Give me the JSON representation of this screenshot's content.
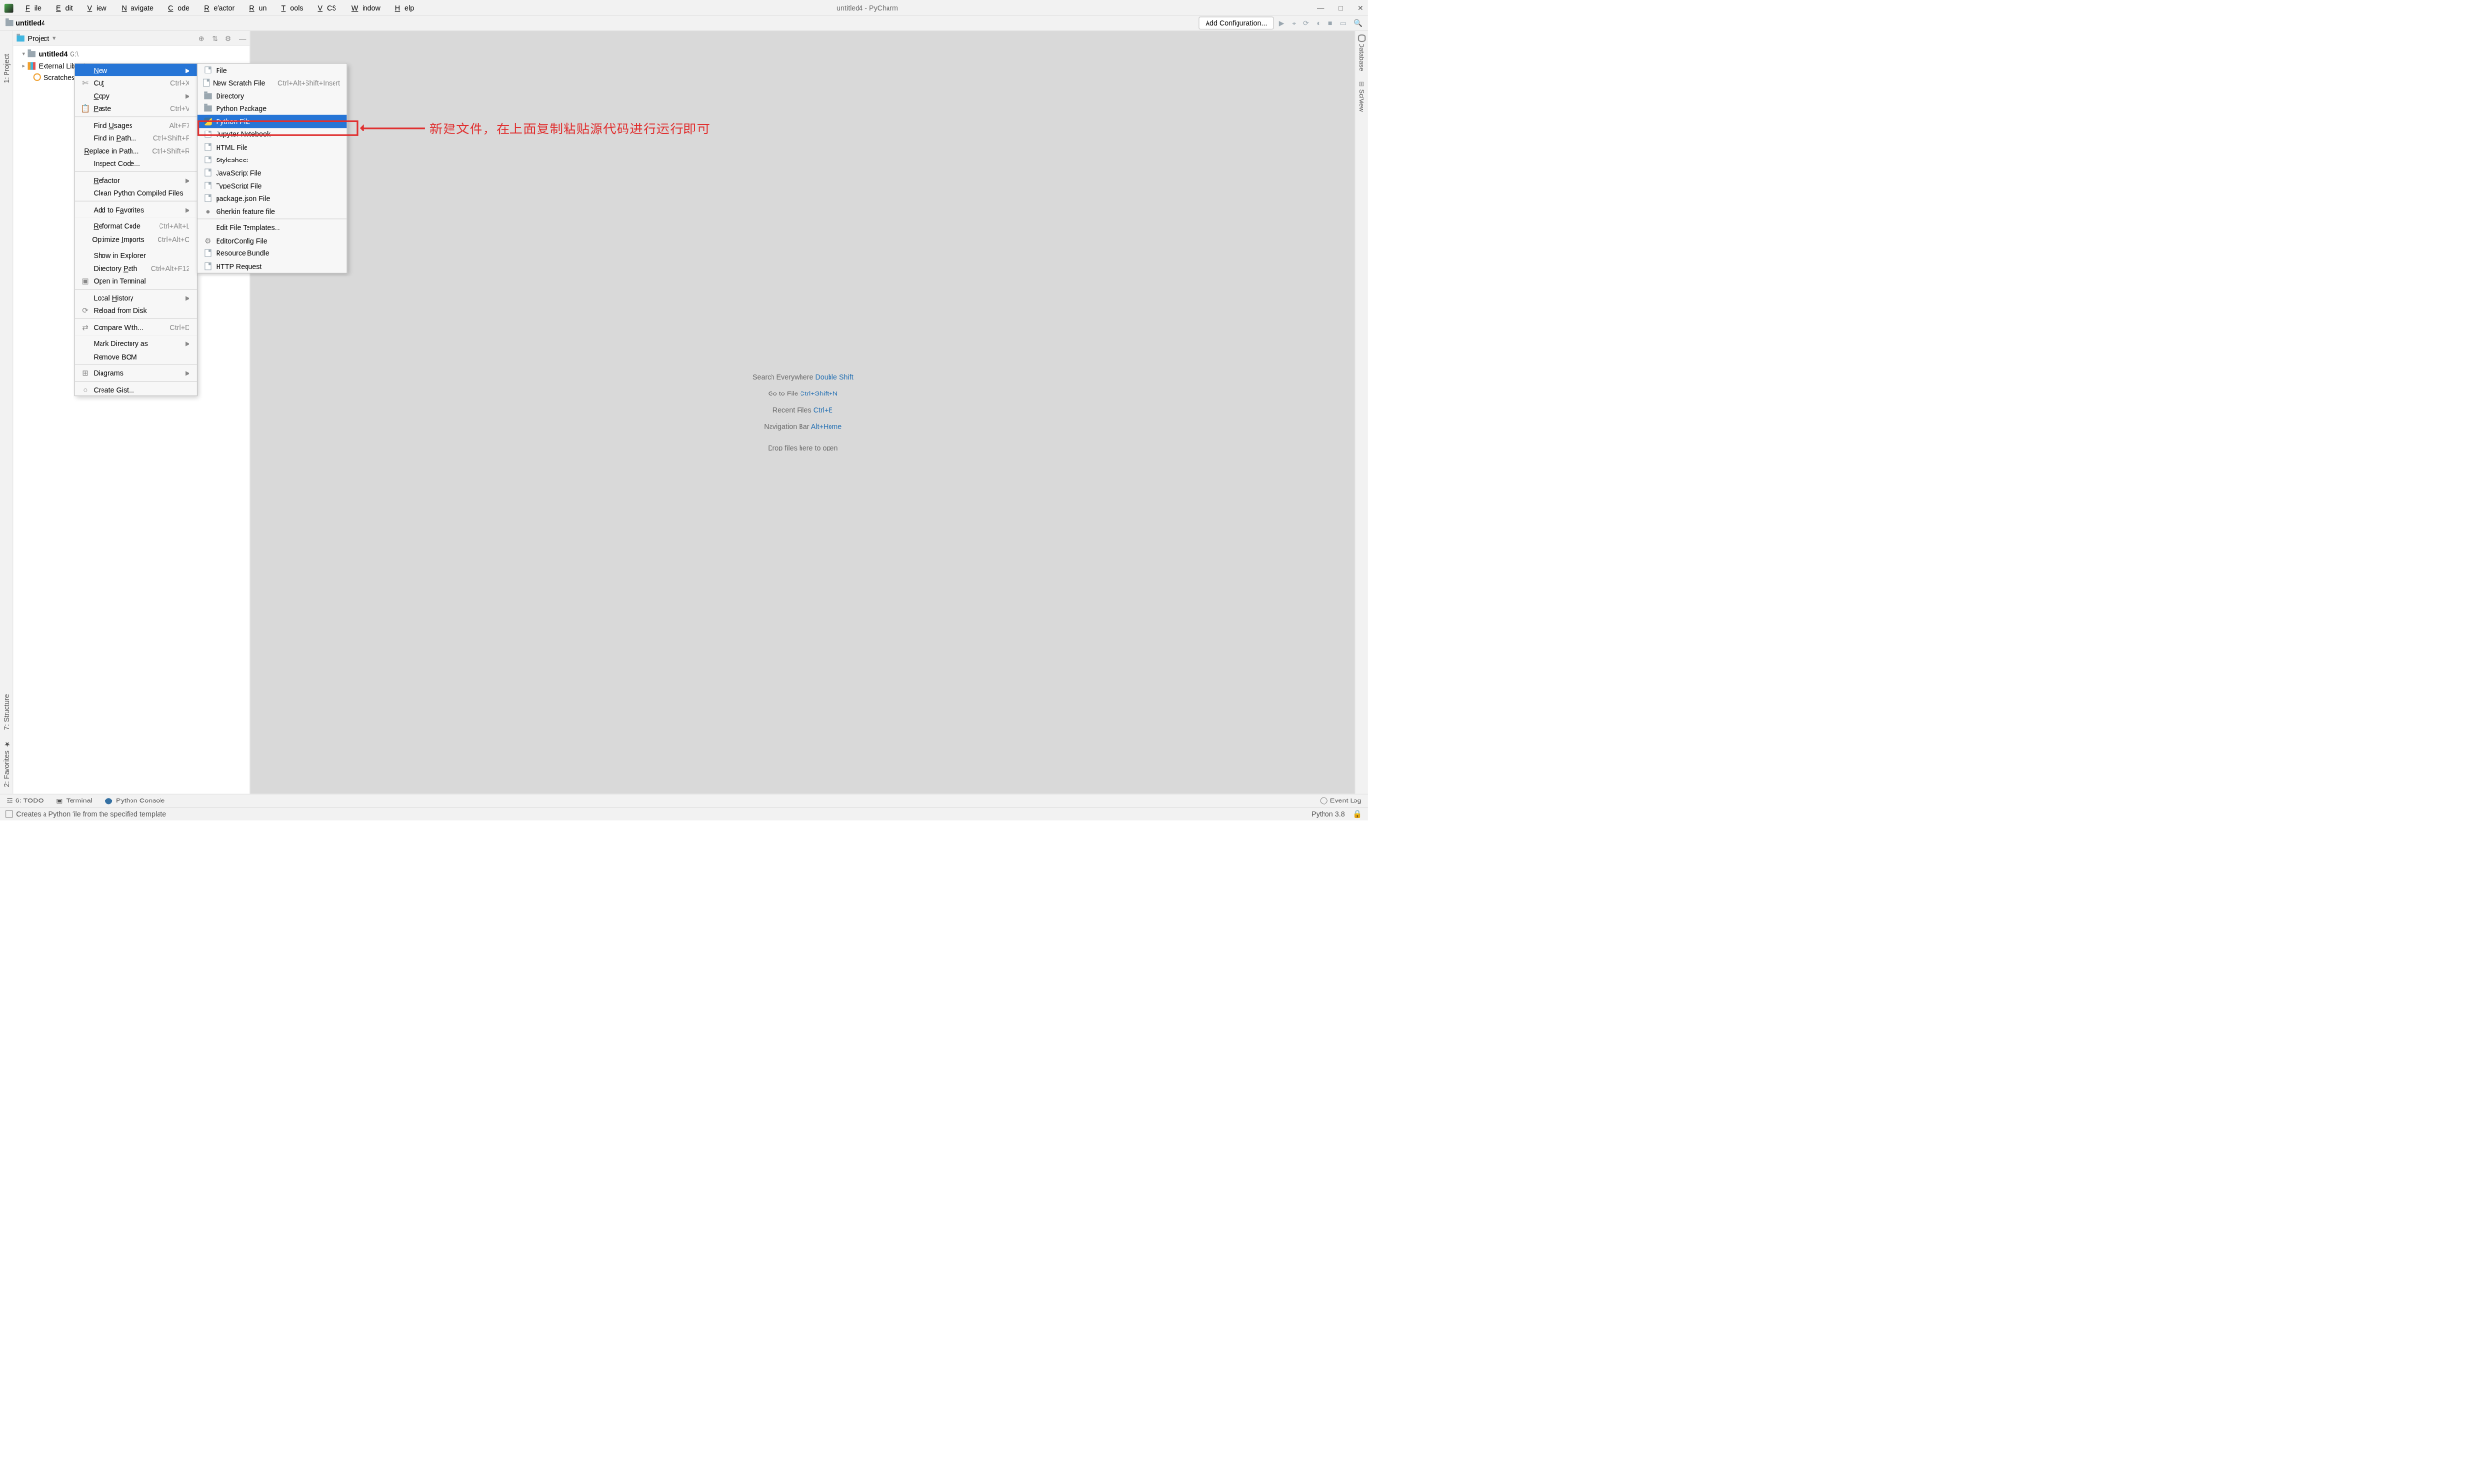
{
  "title": "untitled4 - PyCharm",
  "menubar": [
    "File",
    "Edit",
    "View",
    "Navigate",
    "Code",
    "Refactor",
    "Run",
    "Tools",
    "VCS",
    "Window",
    "Help"
  ],
  "breadcrumb": {
    "project": "untitled4"
  },
  "addConfig": "Add Configuration...",
  "projectPanel": {
    "title": "Project",
    "root": {
      "name": "untitled4",
      "path": "G:\\"
    },
    "extlib": "External Libraries",
    "scratches": "Scratches and Consoles"
  },
  "welcome": {
    "l1a": "Search Everywhere",
    "l1b": "Double Shift",
    "l2a": "Go to File",
    "l2b": "Ctrl+Shift+N",
    "l3a": "Recent Files",
    "l3b": "Ctrl+E",
    "l4a": "Navigation Bar",
    "l4b": "Alt+Home",
    "drop": "Drop files here to open"
  },
  "ctx1": [
    {
      "t": "item",
      "label": "New",
      "sel": true,
      "submenu": true,
      "u": 0
    },
    {
      "t": "item",
      "label": "Cut",
      "sc": "Ctrl+X",
      "icon": "✄",
      "u": 2
    },
    {
      "t": "item",
      "label": "Copy",
      "submenu": true,
      "u": 0
    },
    {
      "t": "item",
      "label": "Paste",
      "sc": "Ctrl+V",
      "icon": "📋",
      "u": 0
    },
    {
      "t": "sep"
    },
    {
      "t": "item",
      "label": "Find Usages",
      "sc": "Alt+F7",
      "u": 5
    },
    {
      "t": "item",
      "label": "Find in Path...",
      "sc": "Ctrl+Shift+F",
      "u": 8
    },
    {
      "t": "item",
      "label": "Replace in Path...",
      "sc": "Ctrl+Shift+R",
      "u": 0
    },
    {
      "t": "item",
      "label": "Inspect Code..."
    },
    {
      "t": "sep"
    },
    {
      "t": "item",
      "label": "Refactor",
      "submenu": true,
      "u": 0
    },
    {
      "t": "item",
      "label": "Clean Python Compiled Files"
    },
    {
      "t": "sep"
    },
    {
      "t": "item",
      "label": "Add to Favorites",
      "submenu": true,
      "u": 8
    },
    {
      "t": "sep"
    },
    {
      "t": "item",
      "label": "Reformat Code",
      "sc": "Ctrl+Alt+L",
      "u": 0
    },
    {
      "t": "item",
      "label": "Optimize Imports",
      "sc": "Ctrl+Alt+O",
      "u": 9
    },
    {
      "t": "sep"
    },
    {
      "t": "item",
      "label": "Show in Explorer"
    },
    {
      "t": "item",
      "label": "Directory Path",
      "sc": "Ctrl+Alt+F12",
      "u": 10
    },
    {
      "t": "item",
      "label": "Open in Terminal",
      "icon": "▣"
    },
    {
      "t": "sep"
    },
    {
      "t": "item",
      "label": "Local History",
      "submenu": true,
      "u": 6
    },
    {
      "t": "item",
      "label": "Reload from Disk",
      "icon": "⟳"
    },
    {
      "t": "sep"
    },
    {
      "t": "item",
      "label": "Compare With...",
      "sc": "Ctrl+D",
      "icon": "⇄"
    },
    {
      "t": "sep"
    },
    {
      "t": "item",
      "label": "Mark Directory as",
      "submenu": true
    },
    {
      "t": "item",
      "label": "Remove BOM"
    },
    {
      "t": "sep"
    },
    {
      "t": "item",
      "label": "Diagrams",
      "submenu": true,
      "icon": "⊞"
    },
    {
      "t": "sep"
    },
    {
      "t": "item",
      "label": "Create Gist...",
      "icon": "○"
    }
  ],
  "ctx2": [
    {
      "t": "item",
      "label": "File",
      "icon": "file"
    },
    {
      "t": "item",
      "label": "New Scratch File",
      "sc": "Ctrl+Alt+Shift+Insert",
      "icon": "file"
    },
    {
      "t": "item",
      "label": "Directory",
      "icon": "dir"
    },
    {
      "t": "item",
      "label": "Python Package",
      "icon": "dir"
    },
    {
      "t": "item",
      "label": "Python File",
      "icon": "py",
      "sel": true
    },
    {
      "t": "item",
      "label": "Jupyter Notebook",
      "icon": "file"
    },
    {
      "t": "item",
      "label": "HTML File",
      "icon": "file"
    },
    {
      "t": "item",
      "label": "Stylesheet",
      "icon": "file"
    },
    {
      "t": "item",
      "label": "JavaScript File",
      "icon": "file"
    },
    {
      "t": "item",
      "label": "TypeScript File",
      "icon": "file"
    },
    {
      "t": "item",
      "label": "package.json File",
      "icon": "file"
    },
    {
      "t": "item",
      "label": "Gherkin feature file",
      "icon": "●"
    },
    {
      "t": "sep"
    },
    {
      "t": "item",
      "label": "Edit File Templates..."
    },
    {
      "t": "item",
      "label": "EditorConfig File",
      "icon": "⚙"
    },
    {
      "t": "item",
      "label": "Resource Bundle",
      "icon": "file"
    },
    {
      "t": "item",
      "label": "HTTP Request",
      "icon": "file"
    }
  ],
  "annotation": "新建文件，在上面复制粘贴源代码进行运行即可",
  "bottombar": {
    "todo": "6: TODO",
    "terminal": "Terminal",
    "pyconsole": "Python Console",
    "eventlog": "Event Log"
  },
  "statusbar": {
    "msg": "Creates a Python file from the specified template",
    "interp": "Python 3.8"
  },
  "leftTools": {
    "project": "1: Project",
    "structure": "7: Structure",
    "favorites": "2: Favorites"
  },
  "rightTools": {
    "database": "Database",
    "sciview": "SciView"
  }
}
